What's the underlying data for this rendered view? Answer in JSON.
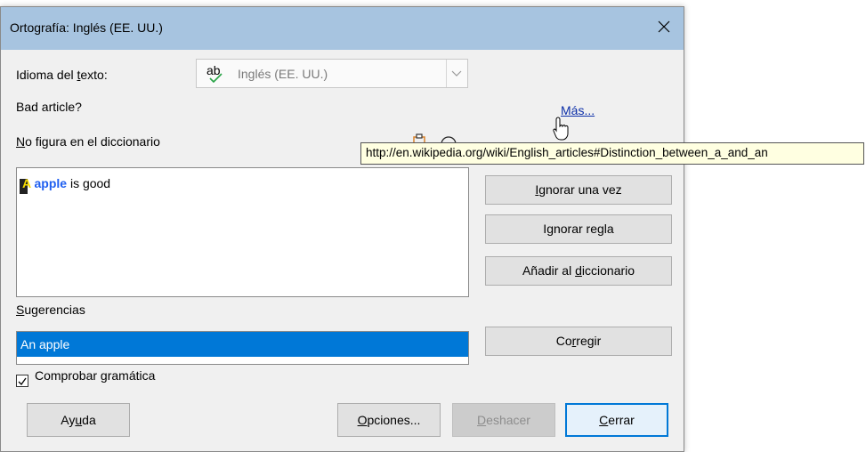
{
  "window": {
    "title": "Ortografía: Inglés (EE. UU.)"
  },
  "language": {
    "label_pre": "Idioma del ",
    "label_u": "t",
    "label_post": "exto:",
    "value": "Inglés (EE. UU.)",
    "icon_text": "ab"
  },
  "issue": {
    "text": "Bad article?"
  },
  "more_link": "Más...",
  "tooltip": "http://en.wikipedia.org/wiki/English_articles#Distinction_between_a_and_an",
  "not_in_dict": {
    "u": "N",
    "rest": "o figura en el diccionario"
  },
  "sentence": {
    "first_letter": "A",
    "highlight_rest": " apple",
    "remainder": " is good"
  },
  "buttons": {
    "ignore_once": {
      "u": "I",
      "rest": "gnorar una vez"
    },
    "ignore_rule": {
      "pre": "I",
      "u": "g",
      "rest": "norar regla"
    },
    "add_dict": {
      "pre": "Añadir al ",
      "u": "d",
      "rest": "iccionario"
    },
    "correct": {
      "pre": "Co",
      "u": "r",
      "rest": "regir"
    },
    "help": {
      "pre": "Ay",
      "u": "u",
      "rest": "da"
    },
    "options": {
      "u": "O",
      "rest": "pciones..."
    },
    "undo": {
      "u": "D",
      "rest": "eshacer"
    },
    "close": {
      "u": "C",
      "rest": "errar"
    }
  },
  "suggestions": {
    "label_u": "S",
    "label_rest": "ugerencias",
    "items": [
      "An apple"
    ]
  },
  "grammar_check": {
    "label_pre": "Comprobar ",
    "label_u": "g",
    "label_rest": "ramática",
    "checked": true
  },
  "colors": {
    "titlebar": "#a7c4e0",
    "selection": "#0078d7",
    "link": "#0b2ea8",
    "highlight": "#1f5ff0",
    "tooltip_bg": "#ffffe1"
  }
}
